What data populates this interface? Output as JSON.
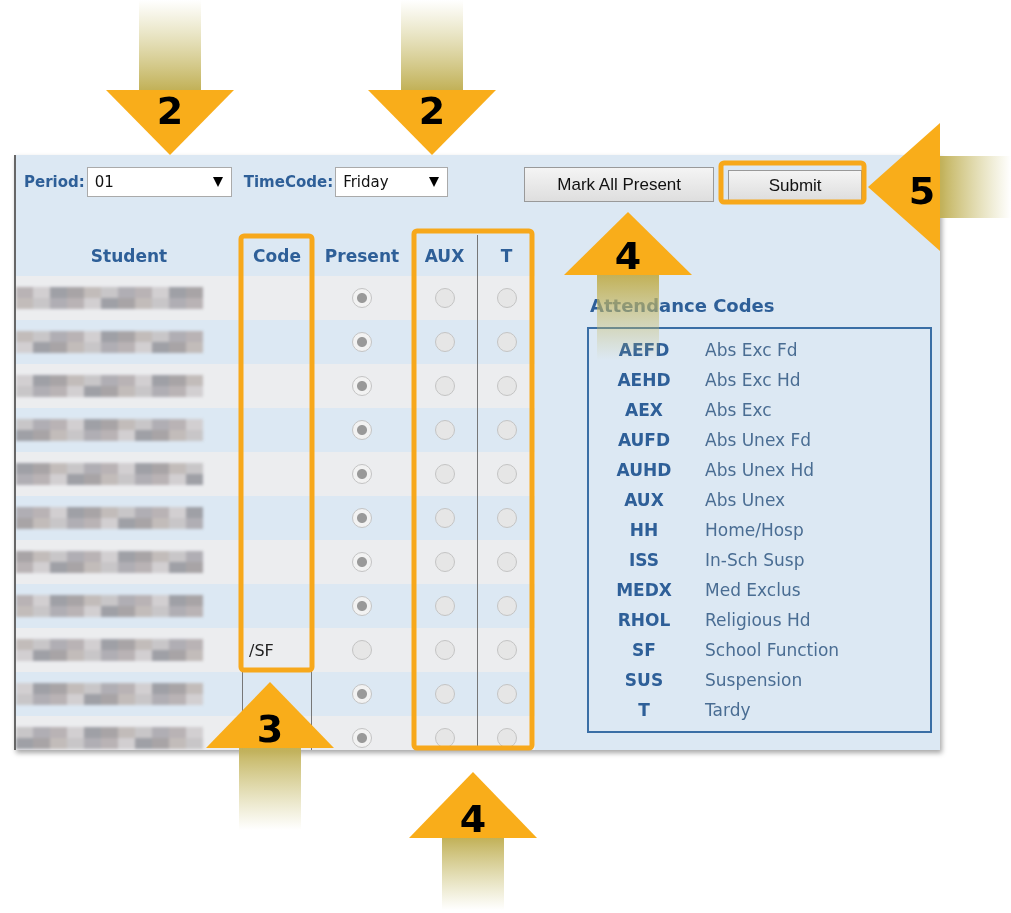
{
  "toolbar": {
    "period": {
      "label": "Period:",
      "value": "01"
    },
    "timecode": {
      "label": "TimeCode:",
      "value": "Friday"
    },
    "buttons": [
      "Mark All Present",
      "Submit"
    ]
  },
  "table": {
    "columns": [
      "Student",
      "Code",
      "Present",
      "AUX",
      "T"
    ],
    "rows": [
      {
        "present": true,
        "aux": false,
        "t": false
      },
      {
        "present": true,
        "aux": false,
        "t": false
      },
      {
        "present": true,
        "aux": false,
        "t": false
      },
      {
        "present": true,
        "aux": false,
        "t": false
      },
      {
        "present": true,
        "aux": false,
        "t": false
      },
      {
        "present": true,
        "aux": false,
        "t": false
      },
      {
        "present": true,
        "aux": false,
        "t": false
      },
      {
        "present": true,
        "aux": false,
        "t": false
      },
      {
        "code": "/SF",
        "present": false,
        "aux": false,
        "t": false
      },
      {
        "present": true,
        "aux": false,
        "t": false
      },
      {
        "present": true,
        "aux": false,
        "t": false
      }
    ]
  },
  "attendance_codes": {
    "title": "Attendance Codes",
    "items": [
      {
        "code": "AEFD",
        "description": "Abs Exc Fd"
      },
      {
        "code": "AEHD",
        "description": "Abs Exc Hd"
      },
      {
        "code": "AEX",
        "description": "Abs Exc"
      },
      {
        "code": "AUFD",
        "description": "Abs Unex Fd"
      },
      {
        "code": "AUHD",
        "description": "Abs Unex Hd"
      },
      {
        "code": "AUX",
        "description": "Abs Unex"
      },
      {
        "code": "HH",
        "description": "Home/Hosp"
      },
      {
        "code": "ISS",
        "description": "In-Sch Susp"
      },
      {
        "code": "MEDX",
        "description": "Med Exclus"
      },
      {
        "code": "RHOL",
        "description": "Religious Hd"
      },
      {
        "code": "SF",
        "description": "School Function"
      },
      {
        "code": "SUS",
        "description": "Suspension"
      },
      {
        "code": "T",
        "description": "Tardy"
      }
    ]
  },
  "annotations": [
    {
      "label": "2",
      "kind": "down"
    },
    {
      "label": "2",
      "kind": "down"
    },
    {
      "label": "4",
      "kind": "up"
    },
    {
      "label": "5",
      "kind": "left"
    },
    {
      "label": "3",
      "kind": "up"
    },
    {
      "label": "4",
      "kind": "up"
    }
  ]
}
